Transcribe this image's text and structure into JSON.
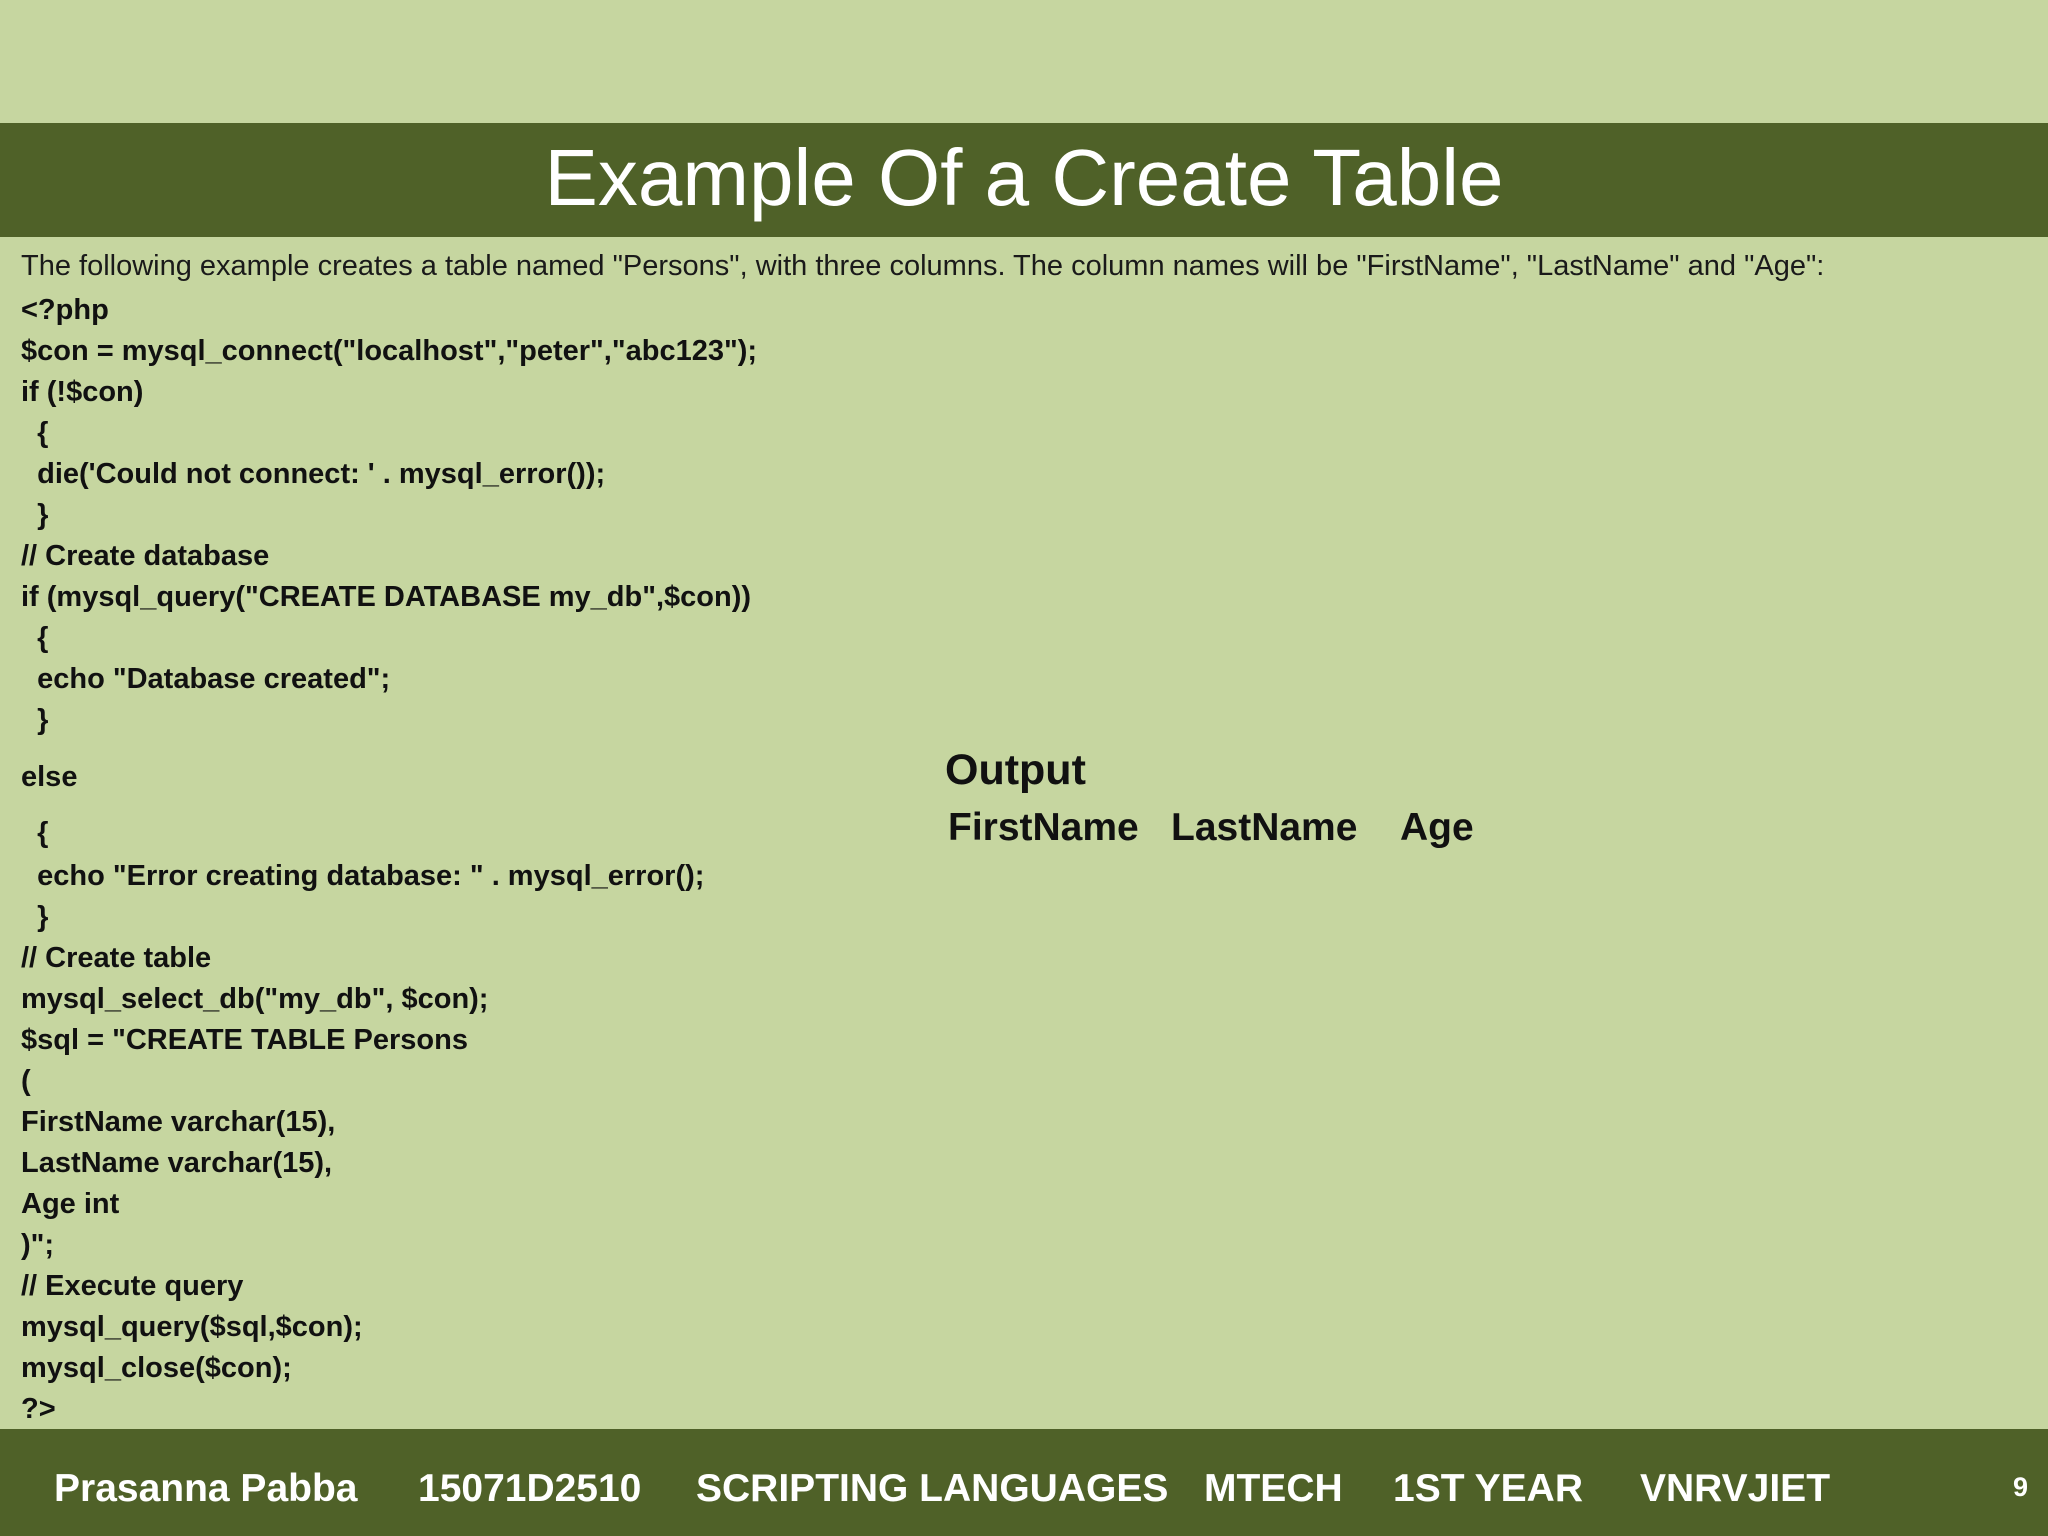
{
  "slide": {
    "title": "Example Of a Create Table",
    "intro": "The following example creates a table named \"Persons\", with three columns. The column names will be \"FirstName\", \"LastName\" and \"Age\":",
    "code_lines": [
      "<?php",
      "$con = mysql_connect(\"localhost\",\"peter\",\"abc123\");",
      "if (!$con)",
      "  {",
      "  die('Could not connect: ' . mysql_error());",
      "  }",
      "// Create database",
      "if (mysql_query(\"CREATE DATABASE my_db\",$con))",
      "  {",
      "  echo \"Database created\";",
      "  }",
      "else",
      "  {",
      "  echo \"Error creating database: \" . mysql_error();",
      "  }",
      "// Create table",
      "mysql_select_db(\"my_db\", $con);",
      "$sql = \"CREATE TABLE Persons",
      "(",
      "FirstName varchar(15),",
      "LastName varchar(15),",
      "Age int",
      ")\";",
      "// Execute query",
      "mysql_query($sql,$con);",
      "mysql_close($con);",
      "?>"
    ],
    "output": {
      "label": "Output",
      "columns": [
        "FirstName",
        "LastName",
        "Age"
      ]
    }
  },
  "footer": {
    "author": "Prasanna Pabba",
    "roll_number": "15071D2510",
    "subject": "SCRIPTING LANGUAGES",
    "course": "MTECH",
    "year": "1ST YEAR",
    "college": "VNRVJIET",
    "page_number": "9"
  },
  "colors": {
    "background": "#c6d6a0",
    "banner": "#4f6128",
    "banner_text": "#ffffff"
  }
}
